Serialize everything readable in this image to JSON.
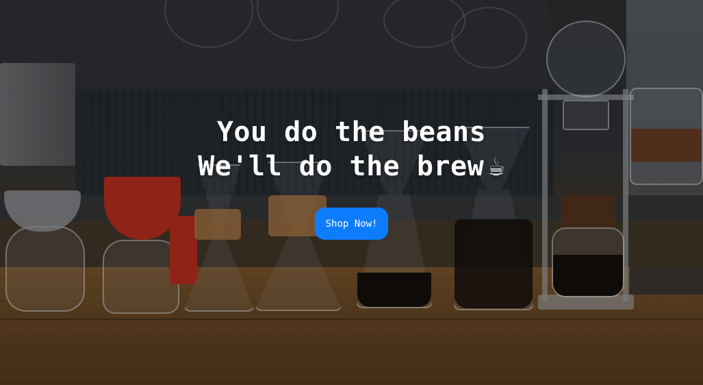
{
  "hero": {
    "headline_line_1": "You do the beans",
    "headline_line_2": "We'll do the brew",
    "cup_icon": "☕",
    "cta_label": "Shop Now!"
  },
  "colors": {
    "accent": "#0d7cff",
    "headline_text": "#ffffff"
  }
}
